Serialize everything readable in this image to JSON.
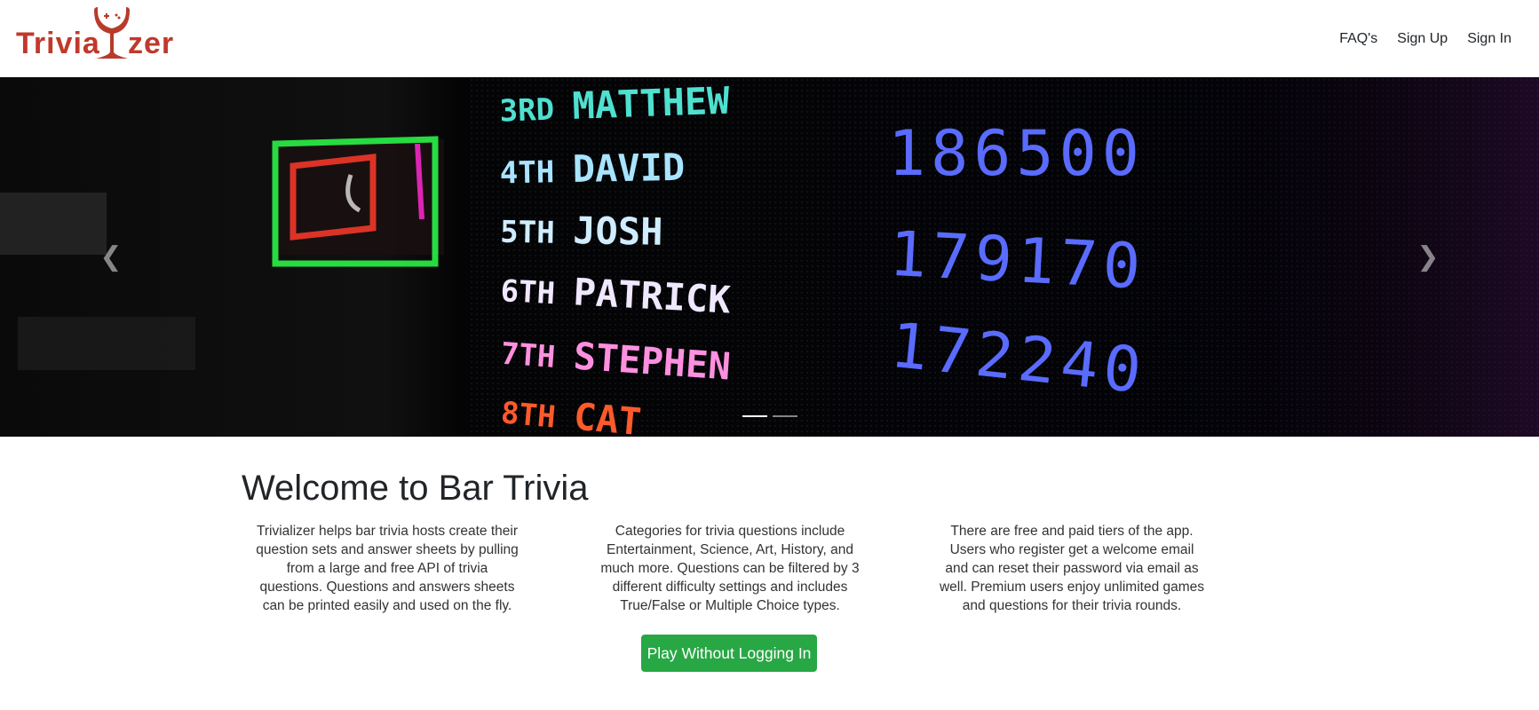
{
  "brand": {
    "name": "Trivializer",
    "accent": "#c0392b"
  },
  "nav": {
    "links": [
      {
        "label": "FAQ's"
      },
      {
        "label": "Sign Up"
      },
      {
        "label": "Sign In"
      }
    ]
  },
  "carousel": {
    "prev_icon": "chevron-left-icon",
    "next_icon": "chevron-right-icon",
    "slide_count": 2,
    "active_slide": 1,
    "scoreboard": {
      "rows": [
        {
          "rank": "3RD",
          "name": "MATTHEW",
          "color": "#4fe0d0"
        },
        {
          "rank": "4TH",
          "name": "DAVID",
          "color": "#a8e4ff"
        },
        {
          "rank": "5TH",
          "name": "JOSH",
          "color": "#d0ecff"
        },
        {
          "rank": "6TH",
          "name": "PATRICK",
          "color": "#f0e8ff"
        },
        {
          "rank": "7TH",
          "name": "STEPHEN",
          "color": "#ff90e0"
        },
        {
          "rank": "8TH",
          "name": "CAT",
          "color": "#ff5a2a"
        }
      ],
      "scores": [
        {
          "value": "186500"
        },
        {
          "value": "179170"
        },
        {
          "value": "172240"
        }
      ]
    }
  },
  "main": {
    "title": "Welcome to Bar Trivia",
    "columns": [
      {
        "text": "Trivializer helps bar trivia hosts create their question sets and answer sheets by pulling from a large and free API of trivia questions. Questions and answers sheets can be printed easily and used on the fly."
      },
      {
        "text": "Categories for trivia questions include Entertainment, Science, Art, History, and much more. Questions can be filtered by 3 different difficulty settings and includes True/False or Multiple Choice types."
      },
      {
        "text": "There are free and paid tiers of the app. Users who register get a welcome email and can reset their password via email as well. Premium users enjoy unlimited games and questions for their trivia rounds."
      }
    ],
    "play_button": "Play Without Logging In",
    "play_color": "#28a745"
  }
}
